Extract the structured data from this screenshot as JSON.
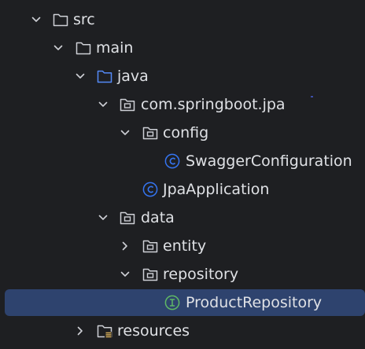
{
  "project_tree": {
    "items": [
      {
        "label": "src",
        "icon": "folder-icon",
        "expanded": true
      },
      {
        "label": "main",
        "icon": "folder-icon",
        "expanded": true
      },
      {
        "label": "java",
        "icon": "source-root-folder-icon",
        "expanded": true
      },
      {
        "label": "com.springboot.jpa",
        "icon": "package-icon",
        "expanded": true
      },
      {
        "label": "config",
        "icon": "package-icon",
        "expanded": true
      },
      {
        "label": "SwaggerConfiguration",
        "icon": "class-icon"
      },
      {
        "label": "JpaApplication",
        "icon": "class-icon"
      },
      {
        "label": "data",
        "icon": "package-icon",
        "expanded": true
      },
      {
        "label": "entity",
        "icon": "package-icon",
        "expanded": false
      },
      {
        "label": "repository",
        "icon": "package-icon",
        "expanded": true
      },
      {
        "label": "ProductRepository",
        "icon": "interface-icon",
        "selected": true
      },
      {
        "label": "resources",
        "icon": "resources-folder-icon",
        "expanded": false
      }
    ]
  },
  "colors": {
    "background": "#1e1f22",
    "text": "#dfe1e5",
    "selection": "#2e436e",
    "icon_gray": "#ced0d6",
    "source_root_blue": "#548af7",
    "class_blue": "#3574f0",
    "interface_green": "#5fb865",
    "resources_accent": "#d6ae58"
  }
}
